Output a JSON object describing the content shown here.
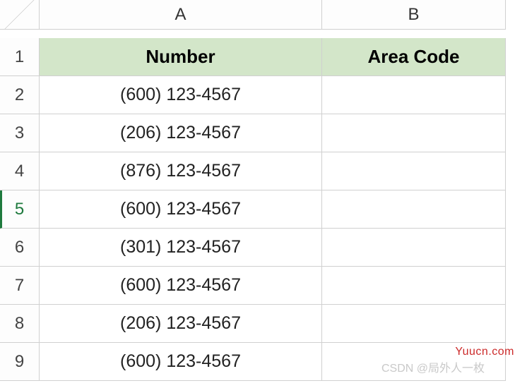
{
  "columns": [
    "A",
    "B"
  ],
  "row_numbers": [
    1,
    2,
    3,
    4,
    5,
    6,
    7,
    8,
    9
  ],
  "active_row": 5,
  "header_row": {
    "A": "Number",
    "B": "Area Code"
  },
  "rows": [
    {
      "A": "(600) 123-4567",
      "B": ""
    },
    {
      "A": "(206) 123-4567",
      "B": ""
    },
    {
      "A": "(876) 123-4567",
      "B": ""
    },
    {
      "A": "(600) 123-4567",
      "B": ""
    },
    {
      "A": "(301) 123-4567",
      "B": ""
    },
    {
      "A": "(600) 123-4567",
      "B": ""
    },
    {
      "A": "(206) 123-4567",
      "B": ""
    },
    {
      "A": "(600) 123-4567",
      "B": ""
    }
  ],
  "watermarks": {
    "site": "Yuucn.com",
    "author": "CSDN @局外人一枚"
  },
  "chart_data": {
    "type": "table",
    "title": "",
    "columns": [
      "Number",
      "Area Code"
    ],
    "data": [
      [
        "(600) 123-4567",
        ""
      ],
      [
        "(206) 123-4567",
        ""
      ],
      [
        "(876) 123-4567",
        ""
      ],
      [
        "(600) 123-4567",
        ""
      ],
      [
        "(301) 123-4567",
        ""
      ],
      [
        "(600) 123-4567",
        ""
      ],
      [
        "(206) 123-4567",
        ""
      ],
      [
        "(600) 123-4567",
        ""
      ]
    ]
  }
}
